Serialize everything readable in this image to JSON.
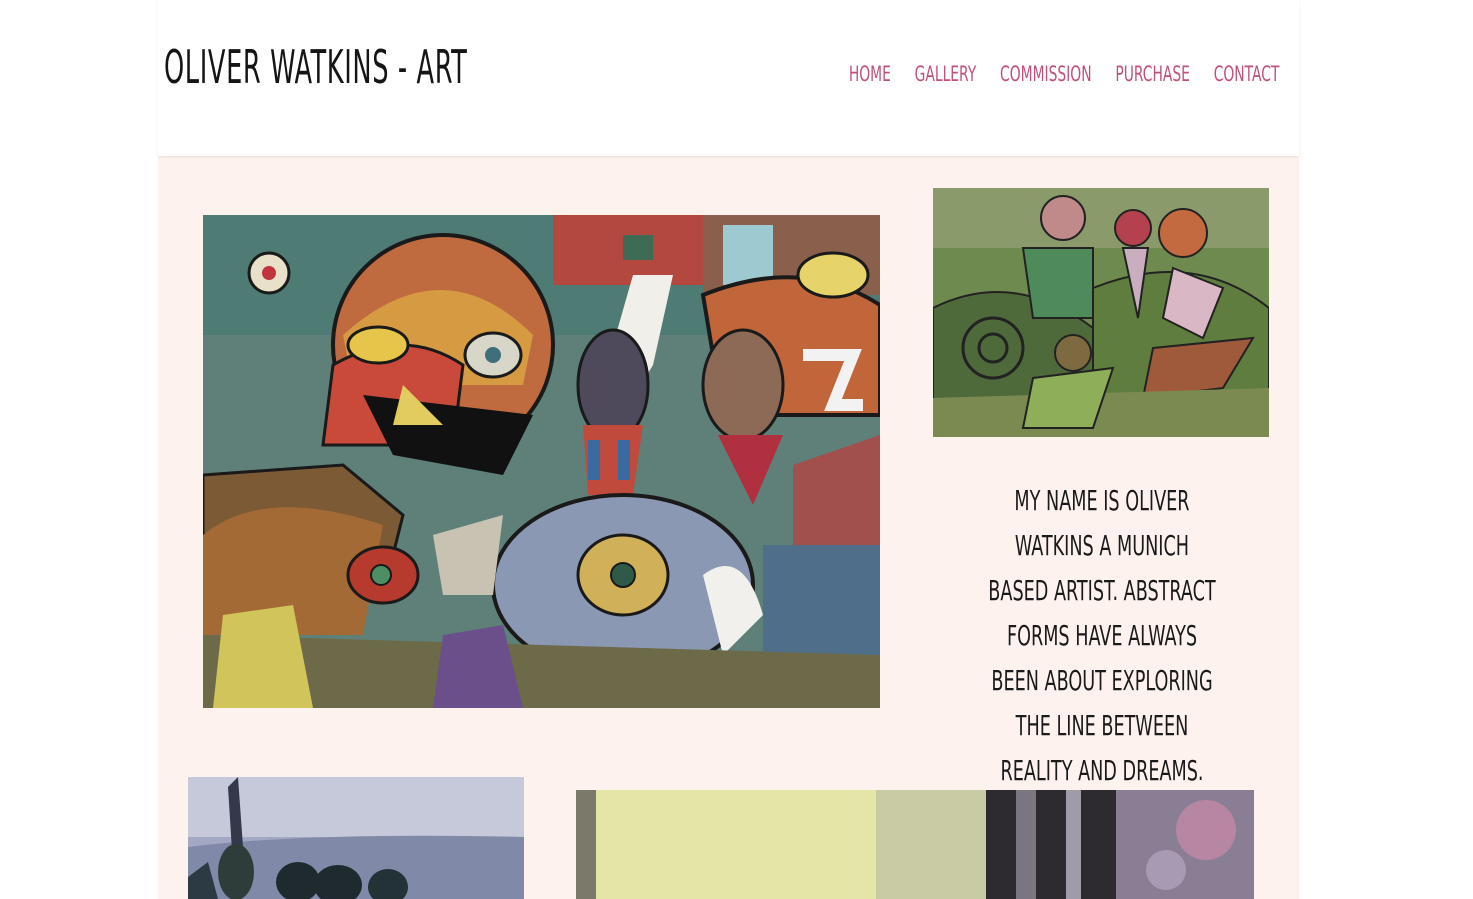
{
  "header": {
    "site_title": "OLIVER WATKINS - ART"
  },
  "nav": {
    "items": [
      {
        "label": "HOME"
      },
      {
        "label": "GALLERY"
      },
      {
        "label": "COMMISSION"
      },
      {
        "label": "PURCHASE"
      },
      {
        "label": "CONTACT"
      }
    ]
  },
  "main": {
    "bio_text": "MY NAME IS OLIVER WATKINS A MUNICH BASED ARTIST. ABSTRACT FORMS HAVE ALWAYS BEEN ABOUT EXPLORING THE LINE BETWEEN REALITY AND DREAMS."
  },
  "colors": {
    "accent": "#c1507a",
    "content_bg": "#fdf2ee",
    "header_bg": "#ffffff",
    "text": "#1a1a1a"
  }
}
